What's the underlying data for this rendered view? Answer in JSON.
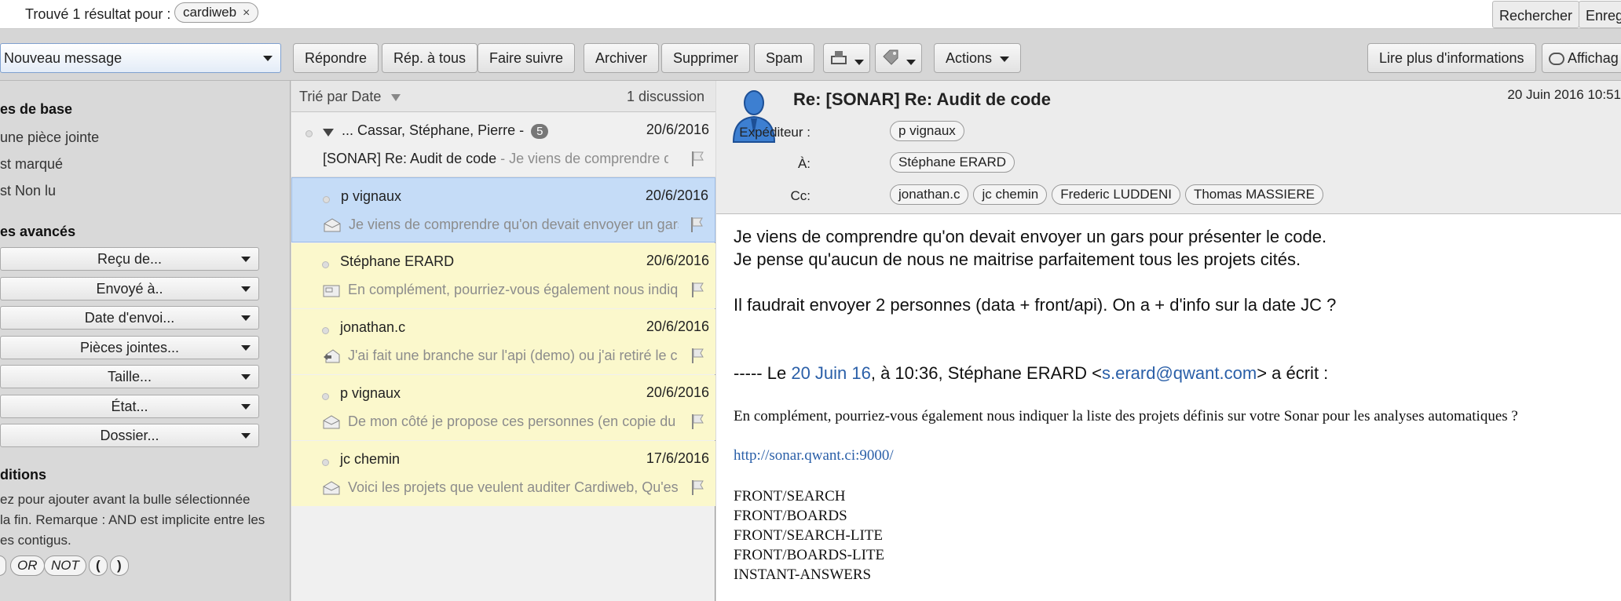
{
  "search": {
    "found_label": "Trouvé 1 résultat pour :",
    "query_chip": "cardiweb",
    "chip_remove": "×",
    "search_button": "Rechercher",
    "save_button": "Enregi"
  },
  "toolbar": {
    "new_message": "Nouveau message",
    "reply": "Répondre",
    "reply_all": "Rép. à tous",
    "forward": "Faire suivre",
    "archive": "Archiver",
    "delete": "Supprimer",
    "spam": "Spam",
    "actions": "Actions",
    "read_more": "Lire plus d'informations",
    "display": "Affichag"
  },
  "filters": {
    "basic_heading": "es de base",
    "basic_items": [
      "une pièce jointe",
      "st marqué",
      "st Non lu"
    ],
    "advanced_heading": "es avancés",
    "advanced_buttons": [
      "Reçu de...",
      "Envoyé à..",
      "Date d'envoi...",
      "Pièces jointes...",
      "Taille...",
      "État...",
      "Dossier..."
    ],
    "conditions_heading": "ditions",
    "conditions_note": [
      "ez pour ajouter avant la bulle sélectionnée",
      "la fin. Remarque : AND est implicite entre les",
      "es contigus."
    ],
    "operators": [
      "OR",
      "NOT",
      "(",
      ")"
    ]
  },
  "list": {
    "sort_label": "Trié par Date",
    "count_label": "1 discussion",
    "thread": {
      "participants": "... Cassar, Stéphane, Pierre -",
      "badge": "5",
      "date": "20/6/2016",
      "subject": "[SONAR] Re: Audit de code",
      "snippet": " - Je viens de comprendre qu'"
    },
    "rows": [
      {
        "sender": "p vignaux",
        "date": "20/6/2016",
        "snippet": "Je viens de comprendre qu'on devait envoyer un gars",
        "bg": "#c5dcf7",
        "icon": "envelope-open"
      },
      {
        "sender": "Stéphane ERARD",
        "date": "20/6/2016",
        "snippet": "En complément, pourriez-vous également nous indiq",
        "bg": "#fbf8cc",
        "icon": "envelope-card"
      },
      {
        "sender": "jonathan.c",
        "date": "20/6/2016",
        "snippet": "J'ai fait une branche sur l'api (demo) ou j'ai retiré le c",
        "bg": "#fbf8cc",
        "icon": "envelope-reply"
      },
      {
        "sender": "p vignaux",
        "date": "20/6/2016",
        "snippet": "De mon côté je propose ces personnes (en copie du",
        "bg": "#fbf8cc",
        "icon": "envelope-open"
      },
      {
        "sender": "jc chemin",
        "date": "17/6/2016",
        "snippet": "Voici les projets que veulent auditer Cardiweb, Qu'est",
        "bg": "#fbf8cc",
        "icon": "envelope-open"
      }
    ]
  },
  "message": {
    "subject": "Re: [SONAR] Re: Audit de code",
    "date": "20 Juin 2016 10:51",
    "from_label": "Expéditeur :",
    "from": "p vignaux",
    "to_label": "À:",
    "to": "Stéphane ERARD",
    "cc_label": "Cc:",
    "cc": [
      "jonathan.c",
      "jc chemin",
      "Frederic LUDDENI",
      "Thomas MASSIERE"
    ],
    "line1": "Je viens de comprendre qu'on devait envoyer un gars pour présenter le code.",
    "line2": "Je pense qu'aucun de nous ne maitrise parfaitement tous les projets cités.",
    "line3": "Il faudrait envoyer 2 personnes (data + front/api). On a + d'info sur la date JC ?",
    "quote_prefix": "----- Le ",
    "quote_date": "20 Juin 16",
    "quote_mid": ", à 10:36, Stéphane ERARD <",
    "quote_email": "s.erard@qwant.com",
    "quote_suffix": "> a écrit :",
    "quoted_text": "En complément, pourriez-vous également nous indiquer la liste des projets définis sur votre Sonar pour les analyses automatiques ?",
    "quoted_link": "http://sonar.qwant.ci:9000/",
    "projects": [
      "FRONT/SEARCH",
      "FRONT/BOARDS",
      "FRONT/SEARCH-LITE",
      "FRONT/BOARDS-LITE",
      "INSTANT-ANSWERS"
    ]
  }
}
